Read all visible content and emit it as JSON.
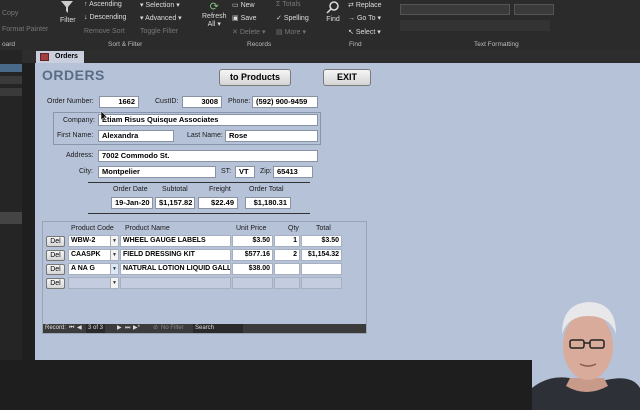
{
  "ribbon": {
    "clipboard": {
      "copy": "Copy",
      "format_painter": "Format Painter",
      "group": "oard"
    },
    "sort_filter": {
      "filter": "Filter",
      "ascending": "Ascending",
      "descending": "Descending",
      "remove_sort": "Remove Sort",
      "selection": "Selection",
      "advanced": "Advanced",
      "toggle_filter": "Toggle Filter",
      "group": "Sort & Filter"
    },
    "records": {
      "refresh": "Refresh",
      "all": "All",
      "new": "New",
      "save": "Save",
      "delete": "Delete",
      "totals": "Totals",
      "spelling": "Spelling",
      "more": "More",
      "group": "Records"
    },
    "find": {
      "find": "Find",
      "replace": "Replace",
      "goto": "Go To",
      "select": "Select",
      "group": "Find"
    },
    "text_formatting": {
      "group": "Text Formatting"
    }
  },
  "tab": {
    "label": "Orders"
  },
  "form": {
    "title": "ORDERS",
    "to_products_button": "to Products",
    "exit_button": "EXIT",
    "order_number_label": "Order Number:",
    "order_number": "1662",
    "custid_label": "CustID:",
    "custid": "3008",
    "phone_label": "Phone:",
    "phone": "(592) 900-9459",
    "company_label": "Company:",
    "company": "Etiam Risus Quisque Associates",
    "first_name_label": "First Name:",
    "first_name": "Alexandra",
    "last_name_label": "Last Name:",
    "last_name": "Rose",
    "address_label": "Address:",
    "address": "7002 Commodo St.",
    "city_label": "City:",
    "city": "Montpelier",
    "st_label": "ST:",
    "st": "VT",
    "zip_label": "Zip:",
    "zip": "65413",
    "order_date_label": "Order Date",
    "order_date": "19-Jan-20",
    "subtotal_label": "Subtotal",
    "subtotal": "$1,157.82",
    "freight_label": "Freight",
    "freight": "$22.49",
    "order_total_label": "Order Total",
    "order_total": "$1,180.31"
  },
  "subform": {
    "headers": {
      "code": "Product Code",
      "name": "Product Name",
      "price": "Unit Price",
      "qty": "Qty",
      "total": "Total"
    },
    "del_label": "Del",
    "rows": [
      {
        "code": "WBW-2",
        "name": "WHEEL GAUGE LABELS",
        "price": "$3.50",
        "qty": "1",
        "total": "$3.50"
      },
      {
        "code": "CAASPK",
        "name": "FIELD DRESSING KIT",
        "price": "$577.16",
        "qty": "2",
        "total": "$1,154.32"
      },
      {
        "code": "A NA G",
        "name": "NATURAL LOTION LIQUID GALL",
        "price": "$38.00",
        "qty": "",
        "total": ""
      },
      {
        "code": "",
        "name": "",
        "price": "",
        "qty": "",
        "total": ""
      }
    ],
    "nav": {
      "record_label": "Record:",
      "position": "3 of 3",
      "filter": "No Filter",
      "search": "Search"
    }
  }
}
